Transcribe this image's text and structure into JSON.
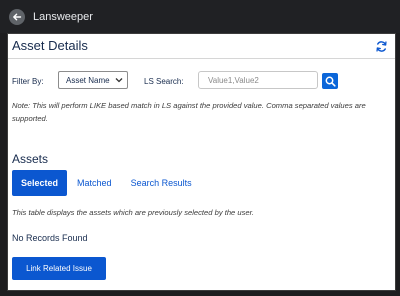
{
  "header": {
    "title": "Lansweeper"
  },
  "panel": {
    "title": "Asset Details"
  },
  "filter": {
    "label": "Filter By:",
    "selected": "Asset Name",
    "search_label": "LS Search:",
    "search_placeholder": "Value1,Value2",
    "search_value": ""
  },
  "note": "Note: This will perform LIKE based match in LS against the provided value. Comma separated values are supported.",
  "assets": {
    "title": "Assets",
    "tabs": [
      {
        "label": "Selected",
        "active": true
      },
      {
        "label": "Matched",
        "active": false
      },
      {
        "label": "Search Results",
        "active": false
      }
    ],
    "description": "This table displays the assets which are previously selected by the user.",
    "empty_text": "No Records Found",
    "link_button": "Link Related Issue"
  },
  "colors": {
    "accent": "#0b57d0",
    "topbar": "#202124",
    "text": "#172b4d"
  },
  "icons": {
    "back": "arrow-left-icon",
    "refresh": "refresh-icon",
    "search": "search-icon",
    "dropdown": "chevron-down-icon"
  }
}
